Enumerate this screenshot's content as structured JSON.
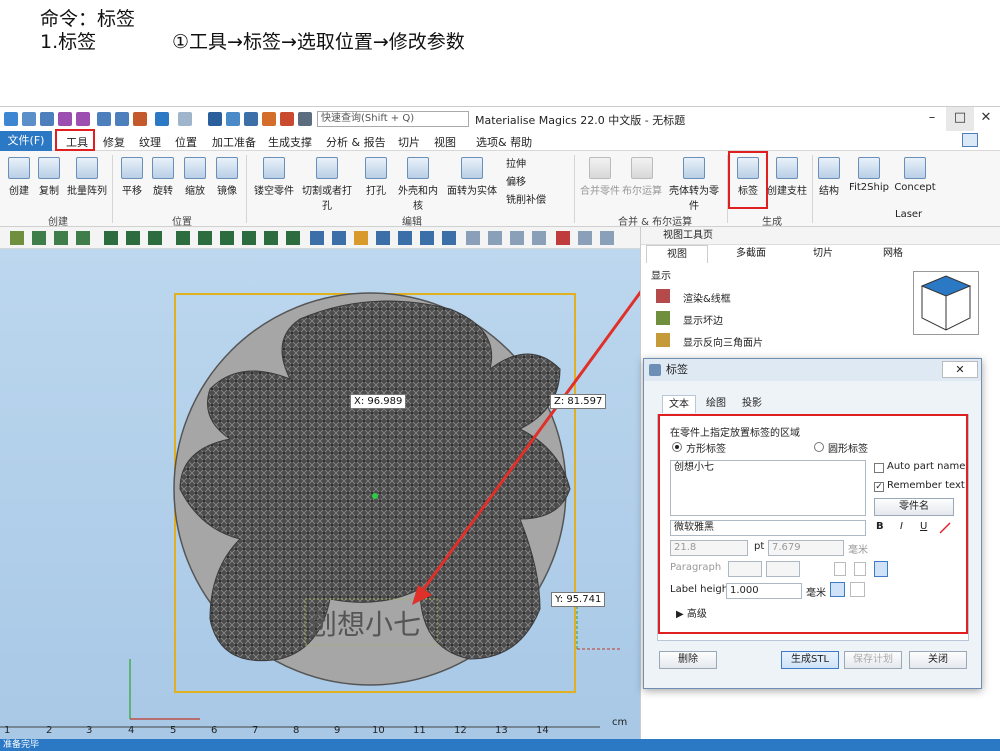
{
  "annotation": {
    "line1": "命令：标签",
    "line2_label": "1.标签",
    "line2_steps": "①工具→标签→选取位置→修改参数"
  },
  "window": {
    "title": "Materialise Magics 22.0 中文版 - 无标题",
    "search_placeholder": "快速查询(Shift + Q)",
    "controls": {
      "minimize": "–",
      "maximize": "□",
      "close": "✕"
    }
  },
  "menubar": {
    "file": "文件(F)",
    "items": [
      "工具",
      "修复",
      "纹理",
      "位置",
      "加工准备",
      "生成支撑",
      "分析 & 报告",
      "切片",
      "视图",
      "选项& 帮助"
    ]
  },
  "ribbon": {
    "create_group": {
      "label": "创建",
      "buttons": [
        "创建",
        "复制",
        "批量阵列"
      ]
    },
    "position_group": {
      "label": "位置",
      "buttons": [
        "平移",
        "旋转",
        "缩放",
        "镜像"
      ]
    },
    "edit_group": {
      "label": "编辑",
      "buttons": [
        "镂空零件",
        "切割或者打孔",
        "打孔",
        "外壳和内核",
        "面转为实体"
      ],
      "small": [
        "拉伸",
        "偏移",
        "铣削补偿"
      ]
    },
    "boolean_group": {
      "label": "合并 & 布尔运算",
      "buttons": [
        "合并零件",
        "布尔运算",
        "壳体转为零件"
      ]
    },
    "generate_group": {
      "label": "生成",
      "buttons": [
        "标签",
        "创建支柱"
      ]
    },
    "extra": [
      "结构",
      "Fit2Ship",
      "Concept"
    ],
    "laser": "Laser"
  },
  "viewport": {
    "coords": {
      "x": "X: 96.989",
      "z": "Z: 81.597",
      "y": "Y: 95.741"
    },
    "label_text": "创想小七",
    "ruler": [
      "1",
      "2",
      "3",
      "4",
      "5",
      "6",
      "7",
      "8",
      "9",
      "10",
      "11",
      "12",
      "13",
      "14"
    ],
    "ruler_unit": "cm",
    "axis_x": "x",
    "axis_y": "y"
  },
  "status": "准备完毕",
  "panel": {
    "title": "视图工具页",
    "tabs": [
      "视图",
      "多截面",
      "切片",
      "网格"
    ],
    "section": "显示",
    "items": [
      "渲染&线框",
      "显示坏边",
      "显示反向三角面片"
    ]
  },
  "dialog": {
    "title": "标签",
    "close": "✕",
    "tabs": [
      "文本",
      "绘图",
      "投影"
    ],
    "heading": "在零件上指定放置标签的区域",
    "radio_rect": "方形标签",
    "radio_circle": "圆形标签",
    "text_value": "创想小七",
    "auto_part_name": "Auto part name",
    "remember_text": "Remember text",
    "part_name_button": "零件名",
    "font": "微软雅黑",
    "size_value": "21.8",
    "pt_label": "pt",
    "pt_value": "7.679",
    "unit_mm": "毫米",
    "paragraph": "Paragraph",
    "label_height": "Label height",
    "label_height_value": "1.000",
    "advanced": "高级",
    "buttons": {
      "delete": "删除",
      "generate": "生成STL",
      "save_plan": "保存计划",
      "close": "关闭"
    }
  },
  "colors": {
    "accent": "#2b78c5",
    "highlight": "#e02020",
    "viewport": "#b4d0ea"
  }
}
